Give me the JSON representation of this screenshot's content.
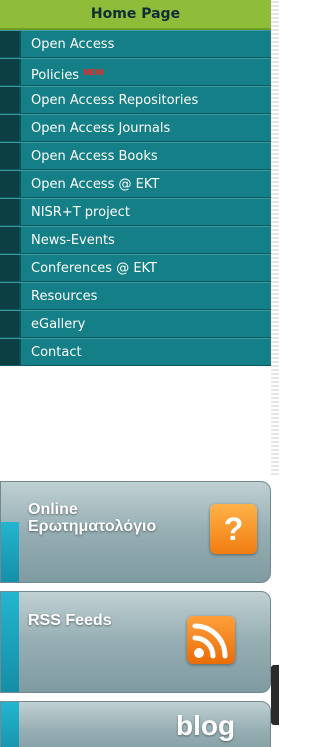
{
  "home": {
    "label": "Home Page"
  },
  "menu": [
    {
      "label": "Open Access",
      "badge": ""
    },
    {
      "label": "Policies",
      "badge": "NEW"
    },
    {
      "label": "Open Access Repositories",
      "badge": ""
    },
    {
      "label": "Open Access Journals",
      "badge": ""
    },
    {
      "label": "Open Access Books",
      "badge": ""
    },
    {
      "label": "Open Access @ EKT",
      "badge": ""
    },
    {
      "label": "NISR+T project",
      "badge": ""
    },
    {
      "label": "News-Events",
      "badge": ""
    },
    {
      "label": "Conferences @ EKT",
      "badge": ""
    },
    {
      "label": "Resources",
      "badge": ""
    },
    {
      "label": "eGallery",
      "badge": ""
    },
    {
      "label": "Contact",
      "badge": ""
    }
  ],
  "banners": {
    "faq": {
      "line1": "Online",
      "line2": "Ερωτηματολόγιο",
      "icon": "question-icon",
      "icon_text": "?"
    },
    "rss": {
      "label": "RSS Feeds",
      "icon": "rss-icon"
    },
    "blog": {
      "label": "blog"
    }
  },
  "colors": {
    "home_bg": "#8fbd3a",
    "menu_bg": "#147f86",
    "menu_tab": "#0b3f44",
    "badge": "#ff2020",
    "icon_orange": "#f07d10"
  }
}
